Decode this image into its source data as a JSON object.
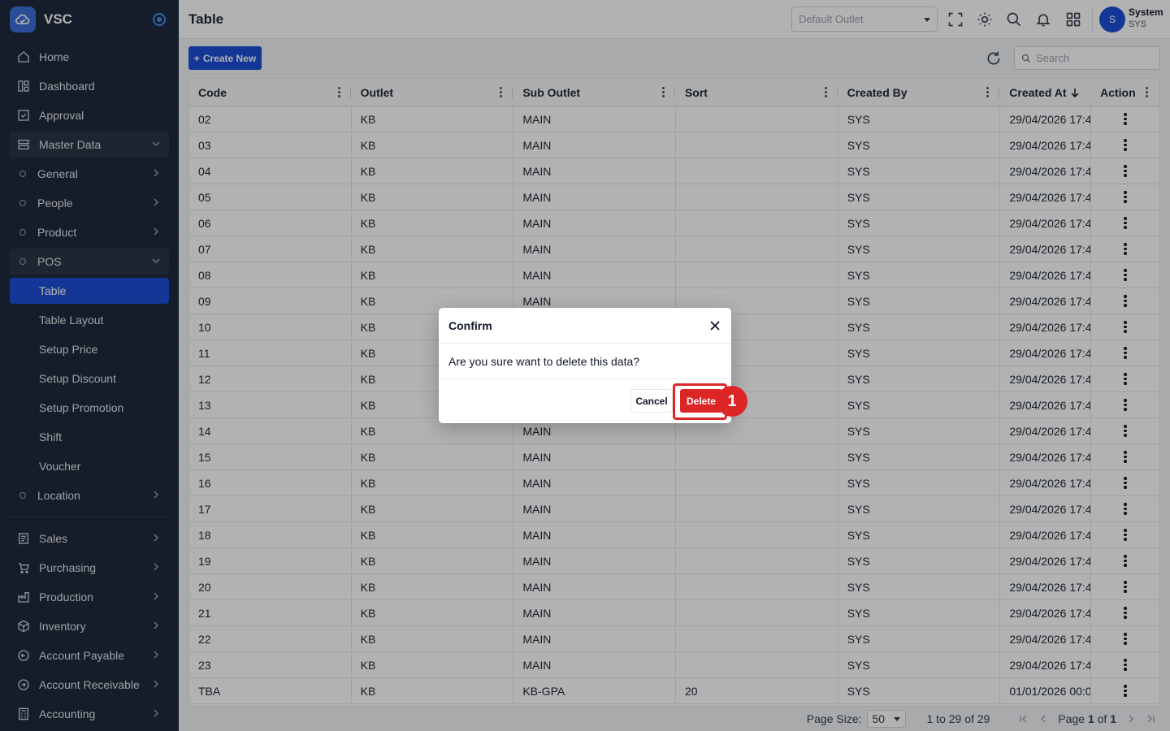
{
  "brand": {
    "name": "VSC"
  },
  "sidebar": {
    "items": [
      {
        "label": "Home",
        "icon": "home-icon"
      },
      {
        "label": "Dashboard",
        "icon": "dashboard-icon"
      },
      {
        "label": "Approval",
        "icon": "approval-icon"
      },
      {
        "label": "Master Data",
        "icon": "database-icon"
      },
      {
        "label": "General"
      },
      {
        "label": "People"
      },
      {
        "label": "Product"
      },
      {
        "label": "POS"
      },
      {
        "label": "Table"
      },
      {
        "label": "Table Layout"
      },
      {
        "label": "Setup Price"
      },
      {
        "label": "Setup Discount"
      },
      {
        "label": "Setup Promotion"
      },
      {
        "label": "Shift"
      },
      {
        "label": "Voucher"
      },
      {
        "label": "Location"
      },
      {
        "label": "Sales",
        "icon": "sales-icon"
      },
      {
        "label": "Purchasing",
        "icon": "cart-icon"
      },
      {
        "label": "Production",
        "icon": "factory-icon"
      },
      {
        "label": "Inventory",
        "icon": "box-icon"
      },
      {
        "label": "Account Payable",
        "icon": "payable-icon"
      },
      {
        "label": "Account Receivable",
        "icon": "receivable-icon"
      },
      {
        "label": "Accounting",
        "icon": "calculator-icon"
      }
    ]
  },
  "header": {
    "title": "Table",
    "outlet_placeholder": "Default Outlet",
    "user": {
      "initial": "S",
      "name": "System",
      "code": "SYS"
    }
  },
  "toolbar": {
    "create_label": "Create New",
    "search_placeholder": "Search"
  },
  "table": {
    "columns": [
      "Code",
      "Outlet",
      "Sub Outlet",
      "Sort",
      "Created By",
      "Created At",
      "Action"
    ],
    "rows": [
      [
        "02",
        "KB",
        "MAIN",
        "",
        "SYS",
        "29/04/2026 17:4"
      ],
      [
        "03",
        "KB",
        "MAIN",
        "",
        "SYS",
        "29/04/2026 17:4"
      ],
      [
        "04",
        "KB",
        "MAIN",
        "",
        "SYS",
        "29/04/2026 17:4"
      ],
      [
        "05",
        "KB",
        "MAIN",
        "",
        "SYS",
        "29/04/2026 17:4"
      ],
      [
        "06",
        "KB",
        "MAIN",
        "",
        "SYS",
        "29/04/2026 17:4"
      ],
      [
        "07",
        "KB",
        "MAIN",
        "",
        "SYS",
        "29/04/2026 17:4"
      ],
      [
        "08",
        "KB",
        "MAIN",
        "",
        "SYS",
        "29/04/2026 17:4"
      ],
      [
        "09",
        "KB",
        "MAIN",
        "",
        "SYS",
        "29/04/2026 17:4"
      ],
      [
        "10",
        "KB",
        "",
        "",
        "SYS",
        "29/04/2026 17:4"
      ],
      [
        "11",
        "KB",
        "",
        "",
        "SYS",
        "29/04/2026 17:4"
      ],
      [
        "12",
        "KB",
        "",
        "",
        "SYS",
        "29/04/2026 17:4"
      ],
      [
        "13",
        "KB",
        "",
        "",
        "SYS",
        "29/04/2026 17:4"
      ],
      [
        "14",
        "KB",
        "MAIN",
        "",
        "SYS",
        "29/04/2026 17:4"
      ],
      [
        "15",
        "KB",
        "MAIN",
        "",
        "SYS",
        "29/04/2026 17:4"
      ],
      [
        "16",
        "KB",
        "MAIN",
        "",
        "SYS",
        "29/04/2026 17:4"
      ],
      [
        "17",
        "KB",
        "MAIN",
        "",
        "SYS",
        "29/04/2026 17:4"
      ],
      [
        "18",
        "KB",
        "MAIN",
        "",
        "SYS",
        "29/04/2026 17:4"
      ],
      [
        "19",
        "KB",
        "MAIN",
        "",
        "SYS",
        "29/04/2026 17:4"
      ],
      [
        "20",
        "KB",
        "MAIN",
        "",
        "SYS",
        "29/04/2026 17:4"
      ],
      [
        "21",
        "KB",
        "MAIN",
        "",
        "SYS",
        "29/04/2026 17:4"
      ],
      [
        "22",
        "KB",
        "MAIN",
        "",
        "SYS",
        "29/04/2026 17:4"
      ],
      [
        "23",
        "KB",
        "MAIN",
        "",
        "SYS",
        "29/04/2026 17:4"
      ],
      [
        "TBA",
        "KB",
        "KB-GPA",
        "20",
        "SYS",
        "01/01/2026 00:0"
      ]
    ]
  },
  "pagination": {
    "page_size_label": "Page Size:",
    "page_size": "50",
    "range": "1 to 29 of 29",
    "page_prefix": "Page",
    "current_page": "1",
    "of_label": "of",
    "total_pages": "1"
  },
  "dialog": {
    "title": "Confirm",
    "message": "Are you sure want to delete this data?",
    "cancel_label": "Cancel",
    "delete_label": "Delete"
  },
  "annotation": {
    "step": "1"
  },
  "colors": {
    "primary": "#1d4ed8",
    "danger": "#dc2626",
    "sidebar": "#1e2a3b"
  }
}
